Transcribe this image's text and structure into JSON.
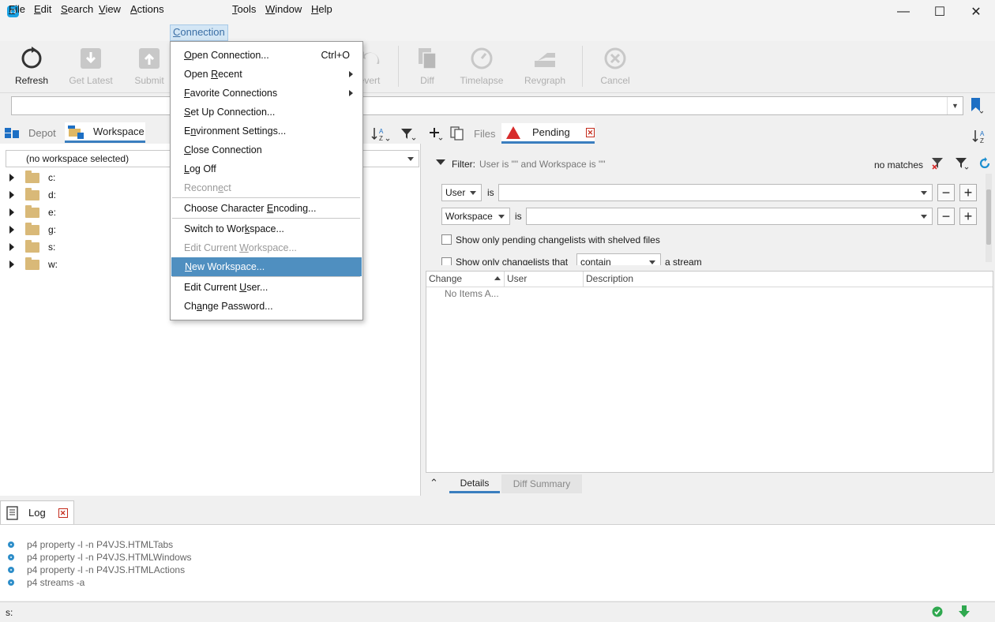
{
  "window": {
    "minimize": "—",
    "maximize": "☐",
    "close": "✕"
  },
  "menubar": {
    "items": [
      {
        "label": "File",
        "u": "F",
        "rest": "ile"
      },
      {
        "label": "Edit",
        "u": "E",
        "rest": "dit"
      },
      {
        "label": "Search",
        "u": "S",
        "rest": "earch"
      },
      {
        "label": "View",
        "u": "V",
        "rest": "iew"
      },
      {
        "label": "Actions",
        "u": "A",
        "rest": "ctions"
      },
      {
        "label": "Connection",
        "u": "C",
        "rest": "onnection"
      },
      {
        "label": "Tools",
        "u": "T",
        "rest": "ools"
      },
      {
        "label": "Window",
        "u": "W",
        "rest": "indow"
      },
      {
        "label": "Help",
        "u": "H",
        "rest": "elp"
      }
    ]
  },
  "toolbar": {
    "refresh": "Refresh",
    "get_latest": "Get Latest",
    "submit": "Submit",
    "revert": "evert",
    "diff": "Diff",
    "timelapse": "Timelapse",
    "revgraph": "Revgraph",
    "cancel": "Cancel"
  },
  "address": {
    "value": ""
  },
  "left": {
    "tab_depot": "Depot",
    "tab_workspace": "Workspace",
    "workspace_combo": "(no workspace selected)",
    "drives": [
      "c:",
      "d:",
      "e:",
      "g:",
      "s:",
      "w:"
    ]
  },
  "right": {
    "tab_files": "Files",
    "tab_pending": "Pending",
    "filter_label": "Filter:",
    "filter_summary": "User is \"\" and Workspace is \"\"",
    "no_matches": "no matches",
    "row1_field": "User",
    "row1_op": "is",
    "row1_value": "",
    "row2_field": "Workspace",
    "row2_op": "is",
    "row2_value": "",
    "check_shelved": "Show only pending changelists with shelved files",
    "check_stream": "Show only changelists that",
    "stream_op": "contain",
    "stream_tail": "a stream",
    "col_change": "Change",
    "col_user": "User",
    "col_description": "Description",
    "no_items": "No Items A...",
    "tab_details": "Details",
    "tab_diff_summary": "Diff Summary"
  },
  "log": {
    "tab": "Log",
    "lines": [
      "p4 property -l -n P4VJS.HTMLTabs",
      "p4 property -l -n P4VJS.HTMLWindows",
      "p4 property -l -n P4VJS.HTMLActions",
      "p4 streams -a"
    ]
  },
  "status": {
    "text": "s:"
  },
  "dropdown": {
    "open_connection": {
      "pre": "",
      "u": "O",
      "post": "pen Connection..."
    },
    "open_connection_shortcut": "Ctrl+O",
    "open_recent": {
      "pre": "Open ",
      "u": "R",
      "post": "ecent"
    },
    "favorite_connections": {
      "pre": "",
      "u": "F",
      "post": "avorite Connections"
    },
    "set_up_connection": {
      "pre": "",
      "u": "S",
      "post": "et Up Connection..."
    },
    "environment_settings": {
      "pre": "E",
      "u": "n",
      "post": "vironment Settings..."
    },
    "close_connection": {
      "pre": "",
      "u": "C",
      "post": "lose Connection"
    },
    "log_off": {
      "pre": "",
      "u": "L",
      "post": "og Off"
    },
    "reconnect": {
      "pre": "Reconn",
      "u": "e",
      "post": "ct"
    },
    "choose_encoding": {
      "pre": "Choose Character ",
      "u": "E",
      "post": "ncoding..."
    },
    "switch_workspace": {
      "pre": "Switch to Wor",
      "u": "k",
      "post": "space..."
    },
    "edit_current_workspace": {
      "pre": "Edit Current ",
      "u": "W",
      "post": "orkspace..."
    },
    "new_workspace": {
      "pre": "",
      "u": "N",
      "post": "ew Workspace..."
    },
    "edit_current_user": {
      "pre": "Edit Current ",
      "u": "U",
      "post": "ser..."
    },
    "change_password": {
      "pre": "Ch",
      "u": "a",
      "post": "nge Password..."
    }
  },
  "colors": {
    "accent": "#3a7ebf",
    "highlight": "#4f8fc0",
    "menu_active_bg": "#d3e6f5"
  }
}
